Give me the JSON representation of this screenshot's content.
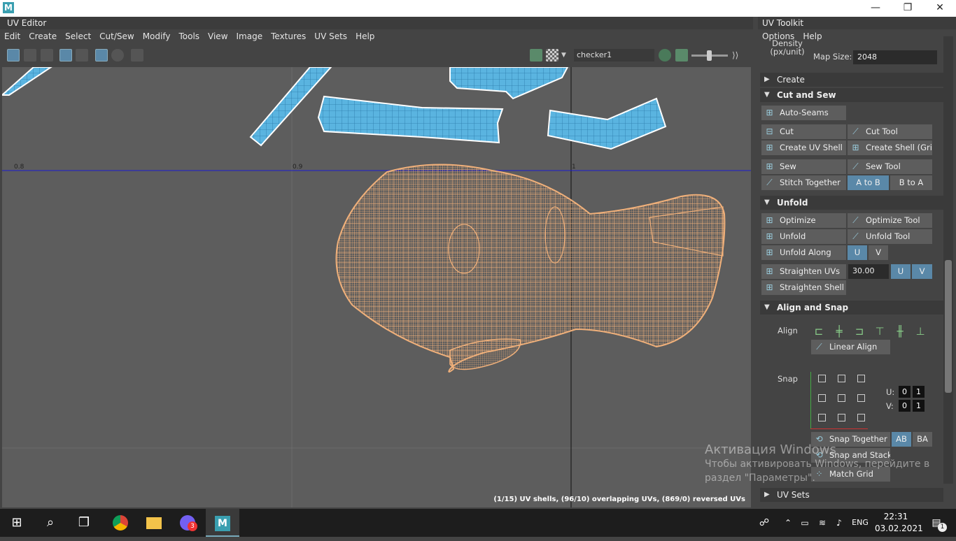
{
  "window": {
    "min": "—",
    "max": "❐",
    "close": "✕",
    "logo": "M"
  },
  "uv_editor": {
    "title": "UV Editor",
    "menu": [
      "Edit",
      "Create",
      "Select",
      "Cut/Sew",
      "Modify",
      "Tools",
      "View",
      "Image",
      "Textures",
      "UV Sets",
      "Help"
    ],
    "texture_field": "checker1",
    "grid_labels": [
      "0.8",
      "0.9",
      "1"
    ],
    "status": "(1/15) UV shells, (96/10) overlapping UVs, (869/0) reversed UVs"
  },
  "toolkit": {
    "title": "UV Toolkit",
    "menu": [
      "Options",
      "Help"
    ],
    "density_label": "Density (px/unit)",
    "map_size_label": "Map Size:",
    "map_size_value": "2048",
    "sections": {
      "create": "Create",
      "cut_and_sew": "Cut and Sew",
      "unfold": "Unfold",
      "align_and_snap": "Align and Snap",
      "uv_sets": "UV Sets"
    },
    "cut_sew_buttons": {
      "auto_seams": "Auto-Seams",
      "cut": "Cut",
      "cut_tool": "Cut Tool",
      "create_uv_shell": "Create UV Shell",
      "create_shell_grid": "Create Shell (Grid)",
      "sew": "Sew",
      "sew_tool": "Sew Tool",
      "stitch_together": "Stitch Together",
      "a_to_b": "A to B",
      "b_to_a": "B to A"
    },
    "unfold_buttons": {
      "optimize": "Optimize",
      "optimize_tool": "Optimize Tool",
      "unfold": "Unfold",
      "unfold_tool": "Unfold Tool",
      "unfold_along": "Unfold Along",
      "u": "U",
      "v": "V",
      "straighten_uvs": "Straighten UVs",
      "straighten_value": "30.00",
      "straighten_shell": "Straighten Shell"
    },
    "align_snap": {
      "align_label": "Align",
      "linear_align": "Linear Align",
      "snap_label": "Snap",
      "u_label": "U:",
      "v_label": "V:",
      "u_values": [
        "0",
        "1"
      ],
      "v_values": [
        "0",
        "1"
      ],
      "snap_together": "Snap Together",
      "ab": "AB",
      "ba": "BA",
      "snap_and_stack": "Snap and Stack",
      "match_grid": "Match Grid"
    }
  },
  "watermark": {
    "line1": "Активация Windows",
    "line2": "Чтобы активировать Windows, перейдите в",
    "line3": "раздел \"Параметры\"."
  },
  "taskbar": {
    "lang": "ENG",
    "time": "22:31",
    "date": "03.02.2021",
    "badge_viber": "3",
    "badge_notify": "1"
  },
  "colors": {
    "accent_blue": "#5a88a8",
    "mesh": "#f0b07a",
    "shell_fill": "#4aa8d8"
  }
}
